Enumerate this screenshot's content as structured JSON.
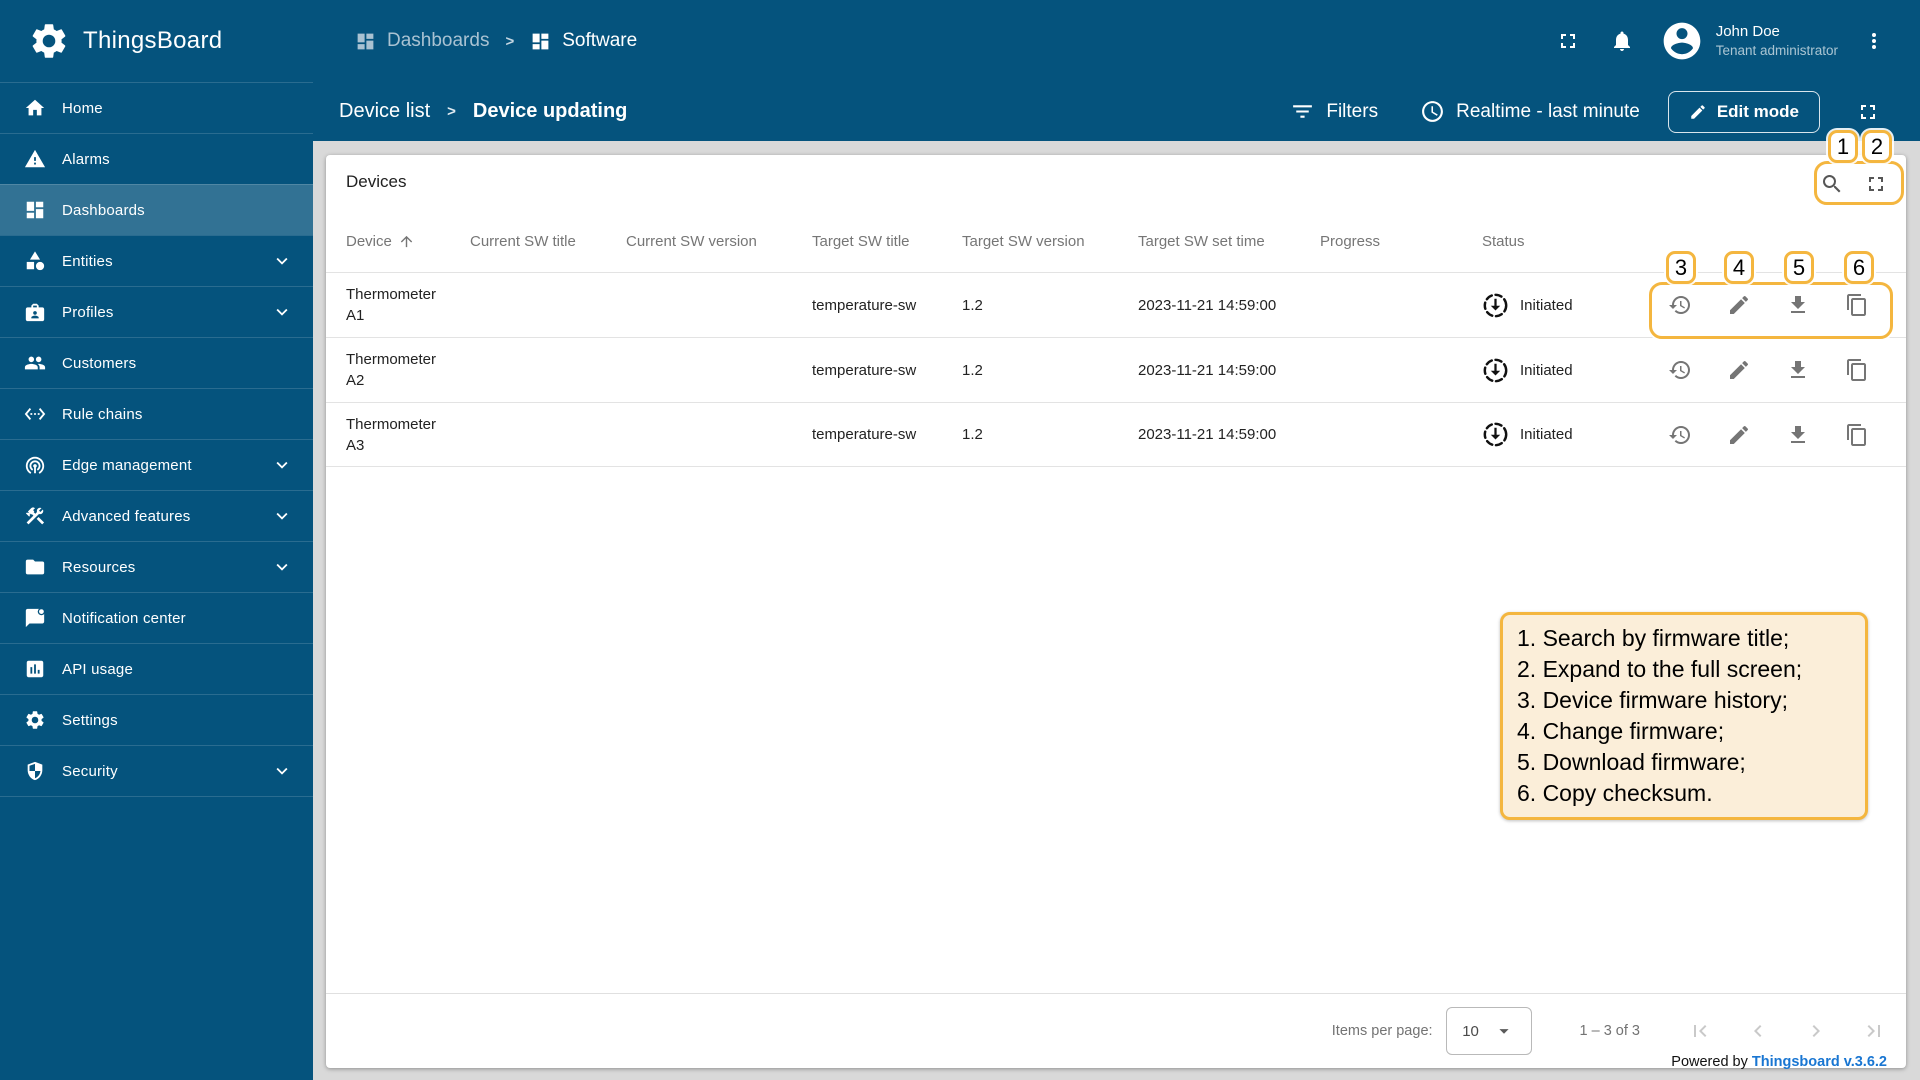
{
  "brand": {
    "name": "ThingsBoard"
  },
  "topbar": {
    "breadcrumb": [
      {
        "label": "Dashboards",
        "icon": "dashboards-icon"
      },
      {
        "label": "Software",
        "icon": "dashboards-icon"
      }
    ],
    "user": {
      "name": "John Doe",
      "role": "Tenant administrator"
    }
  },
  "toolbar": {
    "breadcrumb": [
      {
        "label": "Device list"
      },
      {
        "label": "Device updating"
      }
    ],
    "filters_label": "Filters",
    "timewindow_label": "Realtime - last minute",
    "edit_mode_label": "Edit mode"
  },
  "sidebar": {
    "items": [
      {
        "label": "Home",
        "icon": "home-icon",
        "active": false,
        "expandable": false
      },
      {
        "label": "Alarms",
        "icon": "alarms-icon",
        "active": false,
        "expandable": false
      },
      {
        "label": "Dashboards",
        "icon": "dashboards-icon",
        "active": true,
        "expandable": false
      },
      {
        "label": "Entities",
        "icon": "entities-icon",
        "active": false,
        "expandable": true
      },
      {
        "label": "Profiles",
        "icon": "profiles-icon",
        "active": false,
        "expandable": true
      },
      {
        "label": "Customers",
        "icon": "customers-icon",
        "active": false,
        "expandable": false
      },
      {
        "label": "Rule chains",
        "icon": "rule-chains-icon",
        "active": false,
        "expandable": false
      },
      {
        "label": "Edge management",
        "icon": "edge-management-icon",
        "active": false,
        "expandable": true
      },
      {
        "label": "Advanced features",
        "icon": "advanced-features-icon",
        "active": false,
        "expandable": true
      },
      {
        "label": "Resources",
        "icon": "resources-icon",
        "active": false,
        "expandable": true
      },
      {
        "label": "Notification center",
        "icon": "notification-center-icon",
        "active": false,
        "expandable": false
      },
      {
        "label": "API usage",
        "icon": "api-usage-icon",
        "active": false,
        "expandable": false
      },
      {
        "label": "Settings",
        "icon": "settings-icon",
        "active": false,
        "expandable": false
      },
      {
        "label": "Security",
        "icon": "security-icon",
        "active": false,
        "expandable": true
      }
    ]
  },
  "widget": {
    "title": "Devices",
    "columns": [
      "Device",
      "Current SW title",
      "Current SW version",
      "Target SW title",
      "Target SW version",
      "Target SW set time",
      "Progress",
      "Status"
    ],
    "sort": {
      "column": "Device",
      "direction": "asc"
    },
    "rows": [
      {
        "device": "Thermometer A1",
        "current_sw_title": "",
        "current_sw_version": "",
        "target_sw_title": "temperature-sw",
        "target_sw_version": "1.2",
        "target_sw_set_time": "2023-11-21 14:59:00",
        "progress": "",
        "status": "Initiated"
      },
      {
        "device": "Thermometer A2",
        "current_sw_title": "",
        "current_sw_version": "",
        "target_sw_title": "temperature-sw",
        "target_sw_version": "1.2",
        "target_sw_set_time": "2023-11-21 14:59:00",
        "progress": "",
        "status": "Initiated"
      },
      {
        "device": "Thermometer A3",
        "current_sw_title": "",
        "current_sw_version": "",
        "target_sw_title": "temperature-sw",
        "target_sw_version": "1.2",
        "target_sw_set_time": "2023-11-21 14:59:00",
        "progress": "",
        "status": "Initiated"
      }
    ],
    "row_actions": [
      {
        "name": "device-firmware-history",
        "icon": "history-icon"
      },
      {
        "name": "change-firmware",
        "icon": "edit-icon"
      },
      {
        "name": "download-firmware",
        "icon": "download-icon"
      },
      {
        "name": "copy-checksum",
        "icon": "copy-icon"
      }
    ]
  },
  "annotations": {
    "badges": [
      "1",
      "2",
      "3",
      "4",
      "5",
      "6"
    ],
    "legend": [
      "1. Search by firmware title;",
      "2. Expand to the full screen;",
      "3. Device firmware history;",
      "4. Change firmware;",
      "5. Download firmware;",
      "6. Copy checksum."
    ]
  },
  "pagination": {
    "items_per_page_label": "Items per page:",
    "items_per_page_value": "10",
    "range_label": "1 – 3 of 3"
  },
  "footer": {
    "powered_by": "Powered by",
    "version_link": "Thingsboard v.3.6.2"
  },
  "colors": {
    "primary": "#05537D",
    "sidebar_active": "#2E6F93",
    "annotation_orange": "#F4B63F",
    "legend_bg": "#FBEED9",
    "link_blue": "#1976D2",
    "page_bg": "#D9D9D9",
    "status_icon": "#111111"
  }
}
